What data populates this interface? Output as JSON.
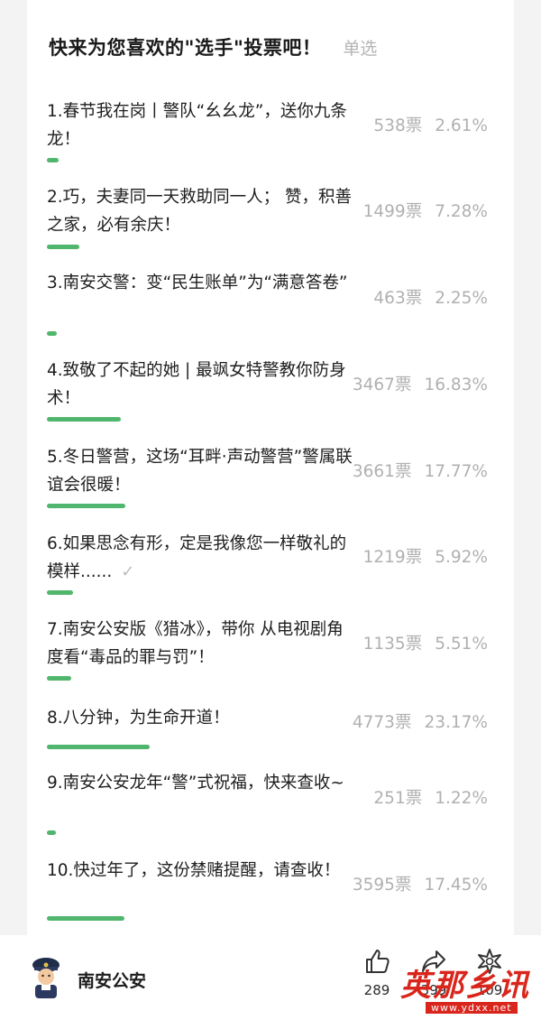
{
  "poll": {
    "title": "快来为您喜欢的\"选手\"投票吧！",
    "mode": "单选",
    "options": [
      {
        "label": "1.春节我在岗丨警队“幺幺龙”，送你九条龙！",
        "votes": "538票",
        "percent": "2.61%",
        "share": 0.0261,
        "checked": false
      },
      {
        "label": "2.巧，夫妻同一天救助同一人； 赞，积善之家，必有余庆！",
        "votes": "1499票",
        "percent": "7.28%",
        "share": 0.0728,
        "checked": false
      },
      {
        "label": "3.南安交警：变“民生账单”为“满意答卷”",
        "votes": "463票",
        "percent": "2.25%",
        "share": 0.0225,
        "checked": false
      },
      {
        "label": "4.致敬了不起的她 | 最飒女特警教你防身术！",
        "votes": "3467票",
        "percent": "16.83%",
        "share": 0.1683,
        "checked": false
      },
      {
        "label": "5.冬日警营，这场“耳畔·声动警营”警属联谊会很暖！",
        "votes": "3661票",
        "percent": "17.77%",
        "share": 0.1777,
        "checked": false
      },
      {
        "label": "6.如果思念有形，定是我像您一样敬礼的模样......",
        "votes": "1219票",
        "percent": "5.92%",
        "share": 0.0592,
        "checked": true
      },
      {
        "label": "7.南安公安版《猎冰》，带你 从电视剧角度看“毒品的罪与罚”！",
        "votes": "1135票",
        "percent": "5.51%",
        "share": 0.0551,
        "checked": false
      },
      {
        "label": "8.八分钟，为生命开道！",
        "votes": "4773票",
        "percent": "23.17%",
        "share": 0.2317,
        "checked": false
      },
      {
        "label": "9.南安公安龙年“警”式祝福，快来查收~",
        "votes": "251票",
        "percent": "1.22%",
        "share": 0.0122,
        "checked": false
      },
      {
        "label": "10.快过年了，这份禁赌提醒，请查收！",
        "votes": "3595票",
        "percent": "17.45%",
        "share": 0.1745,
        "checked": false
      }
    ]
  },
  "footer": {
    "account_name": "南安公安",
    "like_count": "289",
    "share_count": "399",
    "wow_count": "109"
  },
  "watermark": {
    "text": "英那乡讯",
    "url": "www.ydxx.net"
  },
  "colors": {
    "accent": "#51b66d",
    "muted": "#b0b0b0",
    "watermark": "#d9261c"
  }
}
